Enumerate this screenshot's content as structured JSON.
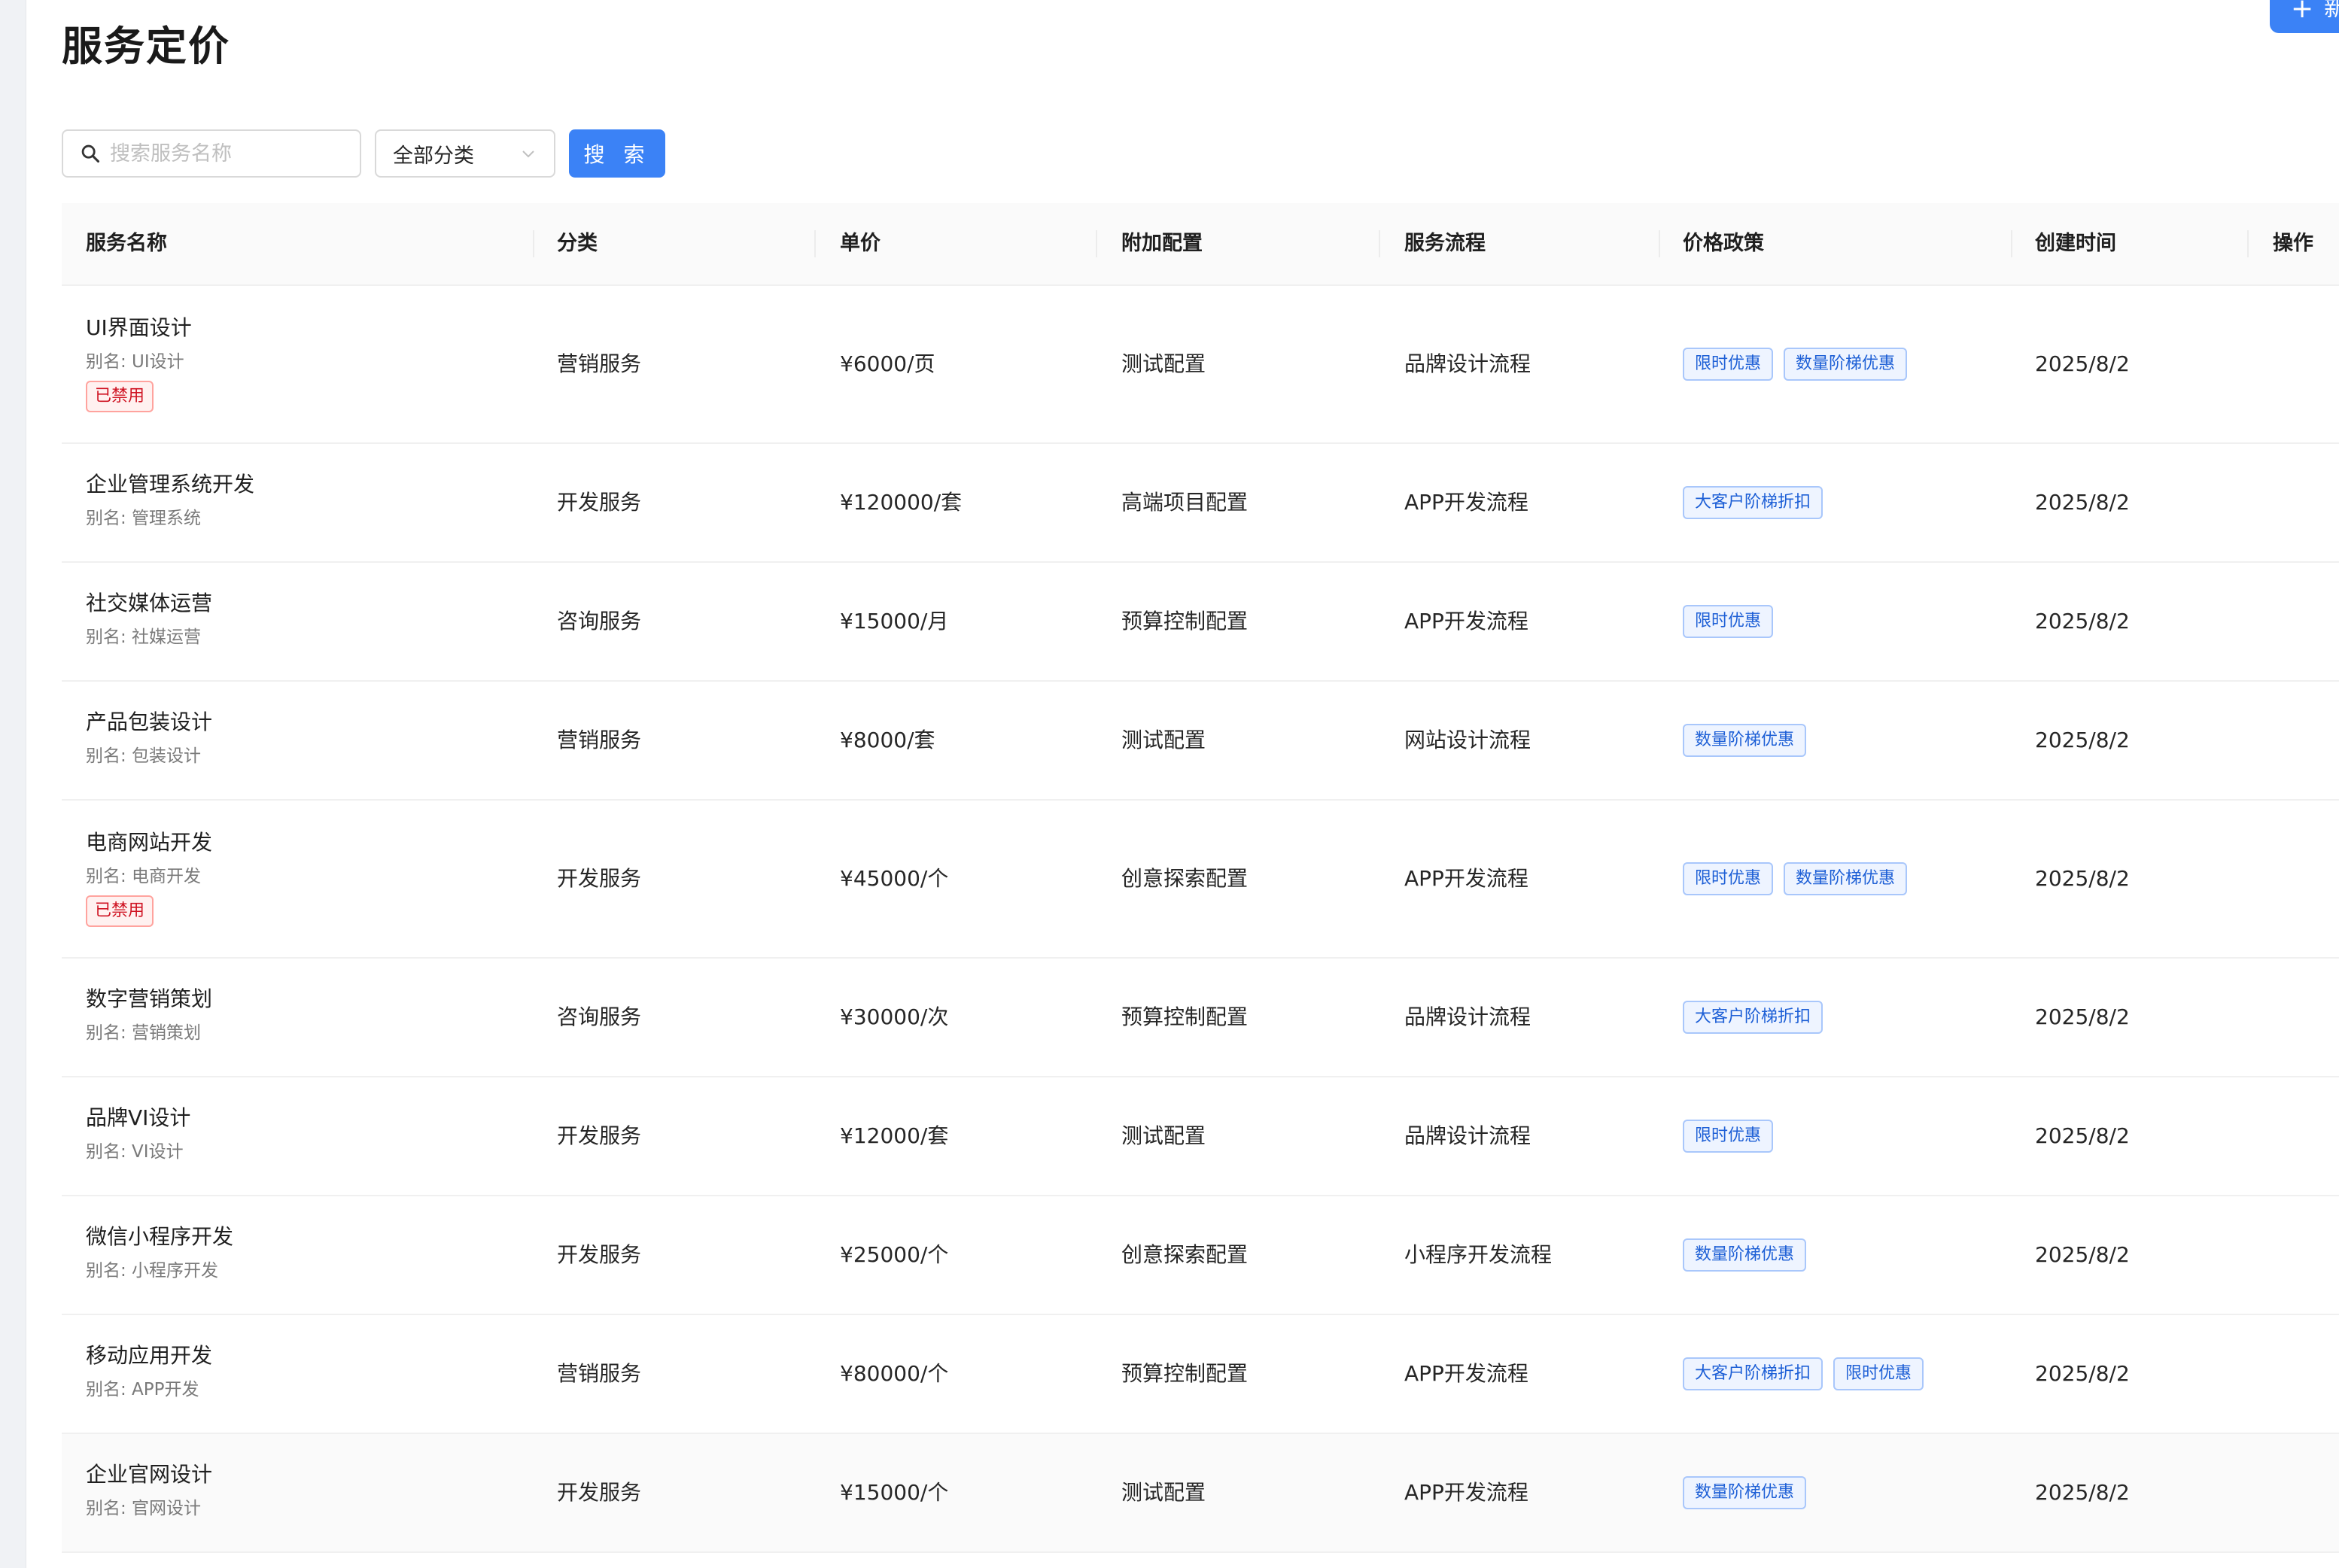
{
  "page": {
    "title": "服务定价",
    "new_button_label": "新"
  },
  "filters": {
    "search_placeholder": "搜索服务名称",
    "category_selected": "全部分类",
    "search_button": "搜 索"
  },
  "table": {
    "columns": [
      "服务名称",
      "分类",
      "单价",
      "附加配置",
      "服务流程",
      "价格政策",
      "创建时间",
      "操作"
    ],
    "rows": [
      {
        "name": "UI界面设计",
        "alias": "别名: UI设计",
        "disabled": true,
        "category": "营销服务",
        "price": "¥6000/页",
        "config": "测试配置",
        "flow": "品牌设计流程",
        "policies": [
          "限时优惠",
          "数量阶梯优惠"
        ],
        "created": "2025/8/2"
      },
      {
        "name": "企业管理系统开发",
        "alias": "别名: 管理系统",
        "disabled": false,
        "category": "开发服务",
        "price": "¥120000/套",
        "config": "高端项目配置",
        "flow": "APP开发流程",
        "policies": [
          "大客户阶梯折扣"
        ],
        "created": "2025/8/2"
      },
      {
        "name": "社交媒体运营",
        "alias": "别名: 社媒运营",
        "disabled": false,
        "category": "咨询服务",
        "price": "¥15000/月",
        "config": "预算控制配置",
        "flow": "APP开发流程",
        "policies": [
          "限时优惠"
        ],
        "created": "2025/8/2"
      },
      {
        "name": "产品包装设计",
        "alias": "别名: 包装设计",
        "disabled": false,
        "category": "营销服务",
        "price": "¥8000/套",
        "config": "测试配置",
        "flow": "网站设计流程",
        "policies": [
          "数量阶梯优惠"
        ],
        "created": "2025/8/2"
      },
      {
        "name": "电商网站开发",
        "alias": "别名: 电商开发",
        "disabled": true,
        "category": "开发服务",
        "price": "¥45000/个",
        "config": "创意探索配置",
        "flow": "APP开发流程",
        "policies": [
          "限时优惠",
          "数量阶梯优惠"
        ],
        "created": "2025/8/2"
      },
      {
        "name": "数字营销策划",
        "alias": "别名: 营销策划",
        "disabled": false,
        "category": "咨询服务",
        "price": "¥30000/次",
        "config": "预算控制配置",
        "flow": "品牌设计流程",
        "policies": [
          "大客户阶梯折扣"
        ],
        "created": "2025/8/2"
      },
      {
        "name": "品牌VI设计",
        "alias": "别名: VI设计",
        "disabled": false,
        "category": "开发服务",
        "price": "¥12000/套",
        "config": "测试配置",
        "flow": "品牌设计流程",
        "policies": [
          "限时优惠"
        ],
        "created": "2025/8/2"
      },
      {
        "name": "微信小程序开发",
        "alias": "别名: 小程序开发",
        "disabled": false,
        "category": "开发服务",
        "price": "¥25000/个",
        "config": "创意探索配置",
        "flow": "小程序开发流程",
        "policies": [
          "数量阶梯优惠"
        ],
        "created": "2025/8/2"
      },
      {
        "name": "移动应用开发",
        "alias": "别名: APP开发",
        "disabled": false,
        "category": "营销服务",
        "price": "¥80000/个",
        "config": "预算控制配置",
        "flow": "APP开发流程",
        "policies": [
          "大客户阶梯折扣",
          "限时优惠"
        ],
        "created": "2025/8/2"
      },
      {
        "name": "企业官网设计",
        "alias": "别名: 官网设计",
        "disabled": false,
        "category": "开发服务",
        "price": "¥15000/个",
        "config": "测试配置",
        "flow": "APP开发流程",
        "policies": [
          "数量阶梯优惠"
        ],
        "created": "2025/8/2"
      }
    ],
    "disabled_label": "已禁用"
  },
  "colors": {
    "primary": "#3b82f6",
    "tag_text": "#1d5fd6",
    "tag_border": "#a9c7fb",
    "danger": "#cf1322"
  },
  "icons": {
    "search": "search-icon",
    "dropdown": "chevron-down-icon",
    "row_action": "more-vertical-icon",
    "add": "plus-icon"
  }
}
